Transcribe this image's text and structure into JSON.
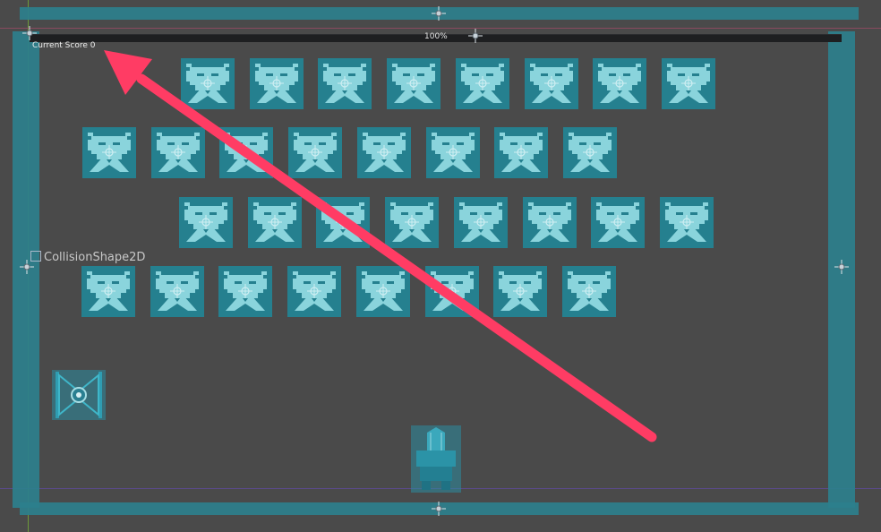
{
  "hud": {
    "score_text": "Current Score 0",
    "zoom_text": "100%"
  },
  "labels": {
    "collision_shape": "CollisionShape2D"
  },
  "colors": {
    "background": "#4a4a4a",
    "wall": "#2c7f8c",
    "enemy_bg": "#25808f",
    "enemy_fg": "#8ad4dc",
    "annotation_arrow": "#ff3c64"
  },
  "icons": {
    "pivot": "pivot-crosshair-icon",
    "enemy": "alien-invader-icon",
    "player": "player-ship-icon",
    "ufo": "tie-fighter-icon",
    "arrow": "annotation-arrow-icon"
  },
  "enemies": {
    "rows": [
      {
        "count": 8
      },
      {
        "count": 8
      },
      {
        "count": 8
      },
      {
        "count": 8
      }
    ]
  }
}
